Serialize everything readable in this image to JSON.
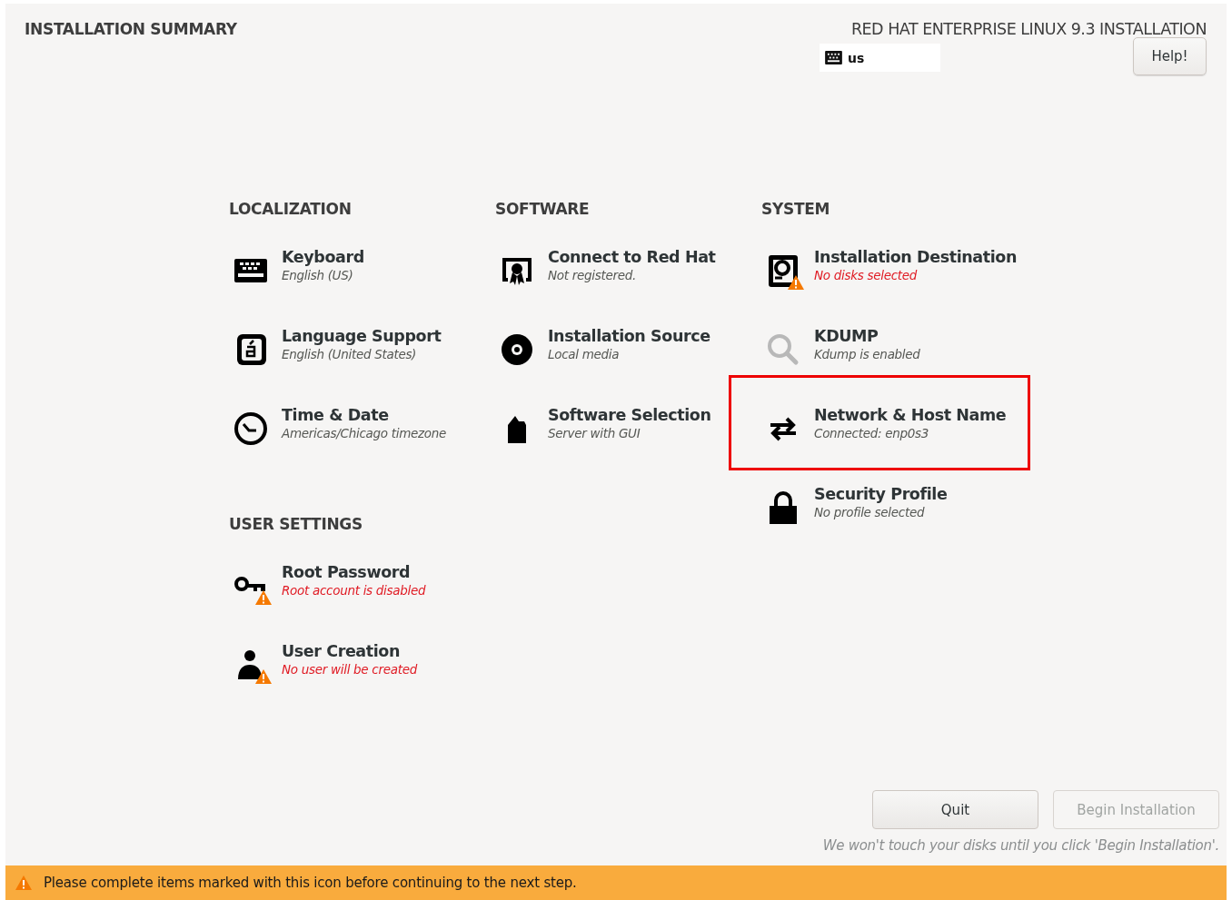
{
  "header": {
    "title": "INSTALLATION SUMMARY",
    "product": "RED HAT ENTERPRISE LINUX 9.3 INSTALLATION",
    "keyboard_layout": "us",
    "help_button": "Help!"
  },
  "columns": [
    {
      "sections": [
        {
          "title": "LOCALIZATION",
          "spokes": [
            {
              "kind": "keyboard",
              "title": "Keyboard",
              "status": "English (US)",
              "warning": false,
              "dimmed": false,
              "highlighted": false
            },
            {
              "kind": "language",
              "title": "Language Support",
              "status": "English (United States)",
              "warning": false,
              "dimmed": false,
              "highlighted": false
            },
            {
              "kind": "clock",
              "title": "Time & Date",
              "status": "Americas/Chicago timezone",
              "warning": false,
              "dimmed": false,
              "highlighted": false
            }
          ]
        },
        {
          "title": "USER SETTINGS",
          "spokes": [
            {
              "kind": "key",
              "title": "Root Password",
              "status": "Root account is disabled",
              "warning": true,
              "dimmed": false,
              "highlighted": false
            },
            {
              "kind": "user",
              "title": "User Creation",
              "status": "No user will be created",
              "warning": true,
              "dimmed": false,
              "highlighted": false
            }
          ]
        }
      ]
    },
    {
      "sections": [
        {
          "title": "SOFTWARE",
          "spokes": [
            {
              "kind": "certificate",
              "title": "Connect to Red Hat",
              "status": "Not registered.",
              "warning": false,
              "dimmed": false,
              "highlighted": false
            },
            {
              "kind": "disc",
              "title": "Installation Source",
              "status": "Local media",
              "warning": false,
              "dimmed": false,
              "highlighted": false
            },
            {
              "kind": "package",
              "title": "Software Selection",
              "status": "Server with GUI",
              "warning": false,
              "dimmed": false,
              "highlighted": false
            }
          ]
        }
      ]
    },
    {
      "sections": [
        {
          "title": "SYSTEM",
          "spokes": [
            {
              "kind": "disk",
              "title": "Installation Destination",
              "status": "No disks selected",
              "warning": true,
              "dimmed": false,
              "highlighted": false
            },
            {
              "kind": "magnifier",
              "title": "KDUMP",
              "status": "Kdump is enabled",
              "warning": false,
              "dimmed": true,
              "highlighted": false
            },
            {
              "kind": "arrows",
              "title": "Network & Host Name",
              "status": "Connected: enp0s3",
              "warning": false,
              "dimmed": false,
              "highlighted": true
            },
            {
              "kind": "lock",
              "title": "Security Profile",
              "status": "No profile selected",
              "warning": false,
              "dimmed": false,
              "highlighted": false
            }
          ]
        }
      ]
    }
  ],
  "footer": {
    "buttons": [
      {
        "label": "Quit",
        "disabled": false
      },
      {
        "label": "Begin Installation",
        "disabled": true
      }
    ],
    "note": "We won't touch your disks until you click 'Begin Installation'."
  },
  "warning_bar": {
    "message": "Please complete items marked with this icon before continuing to the next step."
  }
}
